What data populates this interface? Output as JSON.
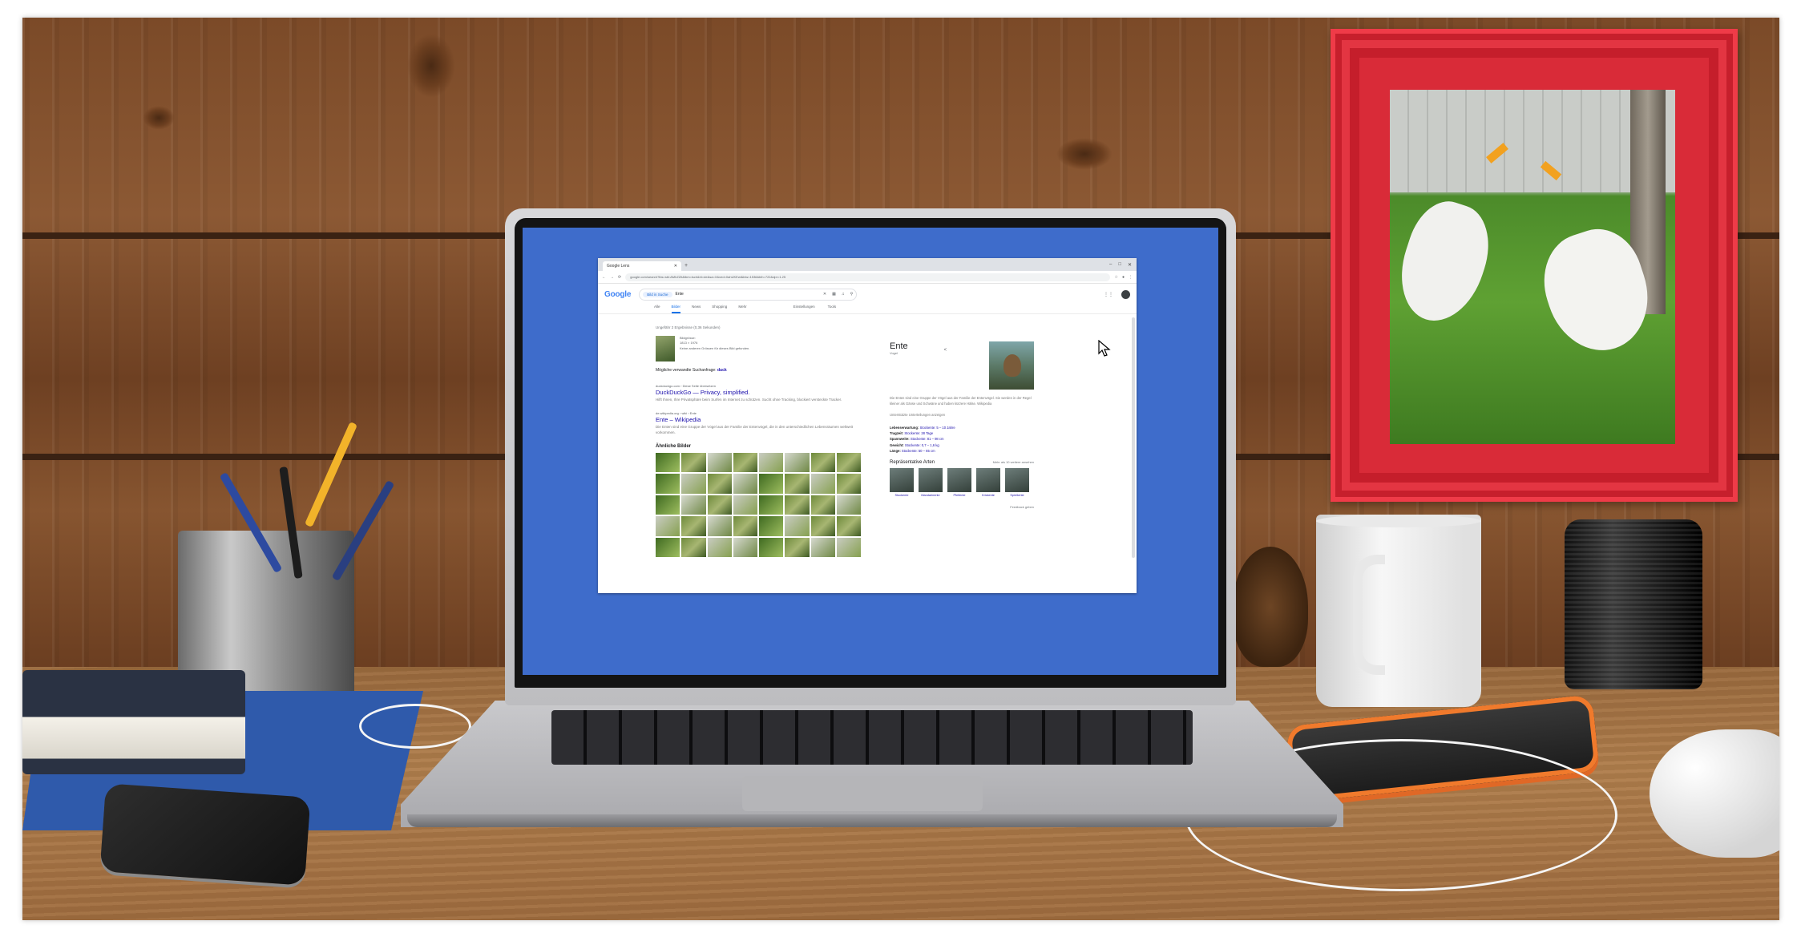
{
  "browser": {
    "tab_title": "Google Lens",
    "new_tab": "+",
    "window_controls": [
      "–",
      "□",
      "✕"
    ],
    "url": "google.com/search?tbs=sbi:AMhZZit&tbm=isch&hl=de&sa=X&ved=0ahUKEwi&biw=1536&bih=722&dpr=1.25"
  },
  "google": {
    "logo": "Google",
    "search_chip": "Bild in Suche",
    "query": "Ente",
    "tabs": [
      "Alle",
      "Bilder",
      "News",
      "Shopping",
      "Mehr"
    ],
    "active_tab": "Bilder",
    "tools": [
      "Einstellungen",
      "Tools"
    ],
    "result_count": "Ungefähr 2 Ergebnisse (0,36 Sekunden)",
    "query_image": {
      "name": "Bildgrösse:",
      "dims": "1813 × 1976",
      "note": "Keine anderen Grössen für dieses Bild gefunden."
    },
    "possible_search_label": "Mögliche verwandte Suchanfrage:",
    "possible_search_link": "duck",
    "results": [
      {
        "site": "duckduckgo.com › Diese Seite übersetzen",
        "title": "DuckDuckGo — Privacy, simplified.",
        "snippet": "Hilft Ihnen, Ihre Privatsphäre beim Surfen im Internet zu schützen. Sucht ohne Tracking, blockiert versteckte Tracker."
      },
      {
        "site": "de.wikipedia.org › wiki › Ente",
        "title": "Ente – Wikipedia",
        "snippet": "Die Enten sind eine Gruppe der Vögel aus der Familie der Entenvögel, die in den unterschiedlichen Lebensräumen weltweit vorkommen."
      }
    ],
    "similar_images_label": "Ähnliche Bilder"
  },
  "knowledge_panel": {
    "title": "Ente",
    "subtitle": "Vogel",
    "description": "Die Enten sind eine Gruppe der Vögel aus der Familie der Entenvögel. Sie werden in der Regel kleiner als Gänse und Schwäne und haben kürzere Hälse. Wikipedia",
    "more_link": "Unterstützte Unterteilungen anzeigen",
    "facts": [
      {
        "label": "Lebenserwartung:",
        "value": "Stockente: 5 – 10 Jahre"
      },
      {
        "label": "Tragzeit:",
        "value": "Stockente: 28 Tage"
      },
      {
        "label": "Spannweite:",
        "value": "Stockente: 81 – 98 cm"
      },
      {
        "label": "Gewicht:",
        "value": "Stockente: 0,7 – 1,6 kg"
      },
      {
        "label": "Länge:",
        "value": "Stockente: 50 – 65 cm"
      }
    ],
    "related_heading": "Repräsentative Arten",
    "related_more": "Mehr als 10 weitere ansehen",
    "related": [
      "Stockente",
      "Mandarinente",
      "Pfeifente",
      "Krickente",
      "Spießente"
    ],
    "feedback": "Feedback geben"
  },
  "colors": {
    "screen_bg": "#3e6ccb",
    "frame": "#d92b38",
    "wall": "#7b4a28",
    "desk": "#a87545"
  }
}
